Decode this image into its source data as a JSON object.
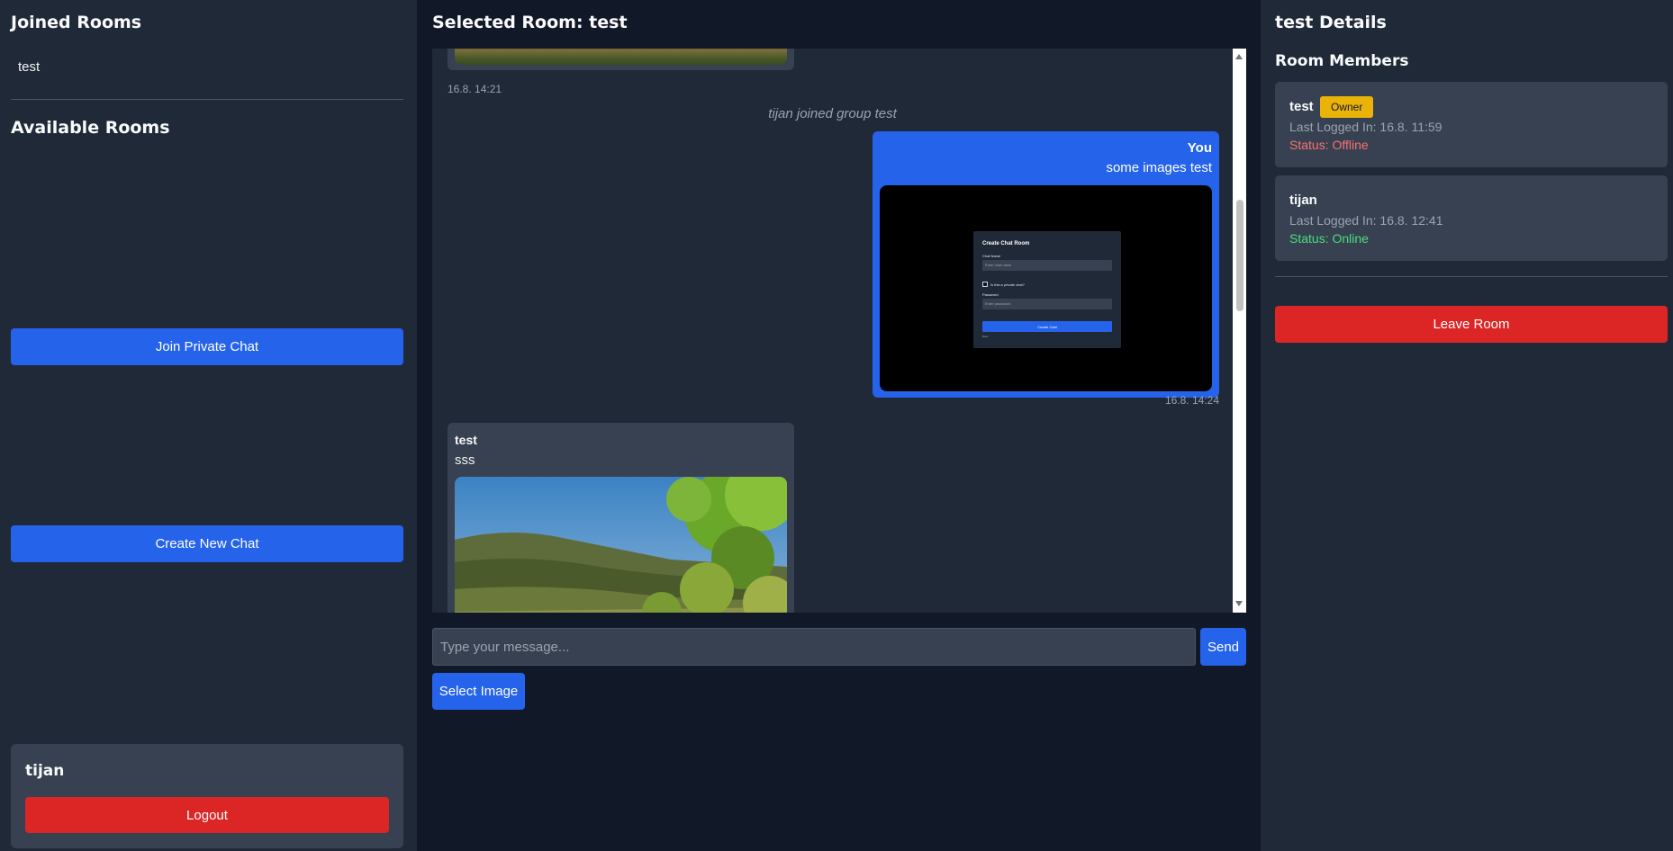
{
  "left": {
    "joined_title": "Joined Rooms",
    "joined_rooms": [
      "test"
    ],
    "available_title": "Available Rooms",
    "join_private_label": "Join Private Chat",
    "create_new_label": "Create New Chat",
    "user": {
      "name": "tijan",
      "logout_label": "Logout"
    }
  },
  "middle": {
    "title": "Selected Room: test",
    "messages": [
      {
        "time": "16.8. 14:21"
      },
      {
        "system": "tijan joined group test"
      },
      {
        "sender": "You",
        "text": "some images test",
        "time": "16.8. 14:24",
        "image": {
          "title": "Create Chat Room",
          "label1": "Chat Name",
          "placeholder1": "Enter chat name",
          "checkbox": "Is this a private chat?",
          "label2": "Password",
          "placeholder2": "Enter password",
          "button": "Create Chat",
          "back": "Back"
        }
      },
      {
        "sender": "test",
        "text": "sss"
      }
    ],
    "input_placeholder": "Type your message...",
    "send_label": "Send",
    "select_image_label": "Select Image"
  },
  "right": {
    "title": "test Details",
    "members_title": "Room Members",
    "members": [
      {
        "name": "test",
        "badge": "Owner",
        "last": "Last Logged In: 16.8. 11:59",
        "status": "Status: Offline"
      },
      {
        "name": "tijan",
        "last": "Last Logged In: 16.8. 12:41",
        "status": "Status: Online"
      }
    ],
    "leave_label": "Leave Room"
  },
  "colors": {
    "primary": "#2563eb",
    "danger": "#dc2626",
    "online": "#4ade80",
    "offline": "#f87171",
    "owner_badge": "#eab308"
  }
}
